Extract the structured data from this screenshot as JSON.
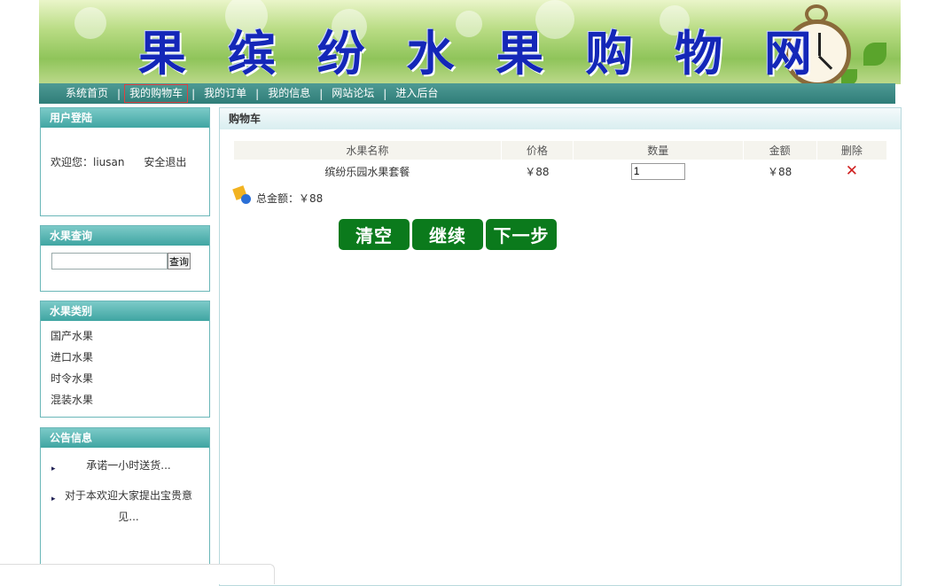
{
  "banner": {
    "title_chars": [
      "果",
      "缤",
      "纷",
      "水",
      "果",
      "购",
      "物",
      "网"
    ]
  },
  "nav": {
    "items": [
      {
        "label": "系统首页"
      },
      {
        "label": "我的购物车",
        "active": true
      },
      {
        "label": "我的订单"
      },
      {
        "label": "我的信息"
      },
      {
        "label": "网站论坛"
      },
      {
        "label": "进入后台"
      }
    ],
    "separator": "|"
  },
  "login": {
    "title": "用户登陆",
    "welcome": "欢迎您：liusan",
    "logout": "安全退出"
  },
  "search": {
    "title": "水果查询",
    "value": "",
    "button": "查询"
  },
  "categories": {
    "title": "水果类别",
    "items": [
      "国产水果",
      "进口水果",
      "时令水果",
      "混装水果"
    ]
  },
  "notices": {
    "title": "公告信息",
    "items": [
      "承诺一小时送货...",
      "对于本欢迎大家提出宝贵意见..."
    ]
  },
  "cart": {
    "title": "购物车",
    "columns": [
      "水果名称",
      "价格",
      "数量",
      "金额",
      "删除"
    ],
    "rows": [
      {
        "name": "缤纷乐园水果套餐",
        "price": "￥88",
        "quantity": "1",
        "amount": "￥88"
      }
    ],
    "total_label": "总金额：￥88",
    "buttons": {
      "clear": "清空",
      "continue": "继续",
      "next": "下一步"
    }
  },
  "colors": {
    "nav_bg": "#2f7d78",
    "box_head": "#3fa5a2",
    "action_button": "#0b7a1c",
    "title_text": "#1427b8"
  }
}
